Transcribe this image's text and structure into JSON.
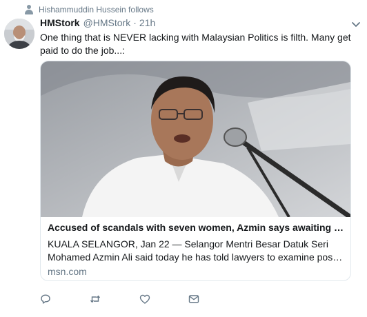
{
  "context": {
    "icon": "person-icon",
    "text": "Hishammuddin Hussein follows"
  },
  "tweet": {
    "author_name": "HMStork",
    "author_handle": "@HMStork",
    "separator": "·",
    "time": "21h",
    "text": "One thing that is NEVER lacking with Malaysian Politics is filth. Many get paid to do the job...:"
  },
  "card": {
    "title": "Accused of scandals with seven women, Azmin says awaiting le...",
    "description_line1": "KUALA SELANGOR, Jan 22 — Selangor Mentri Besar Datuk Seri",
    "description_line2": "Mohamed Azmin Ali said today he has told lawyers to examine possib...",
    "domain": "msn.com"
  },
  "actions": {
    "reply_icon": "reply-icon",
    "retweet_icon": "retweet-icon",
    "like_icon": "heart-icon",
    "dm_icon": "envelope-icon"
  },
  "colors": {
    "text": "#14171a",
    "muted": "#657786",
    "border": "#e1e8ed",
    "icon": "#657786"
  }
}
